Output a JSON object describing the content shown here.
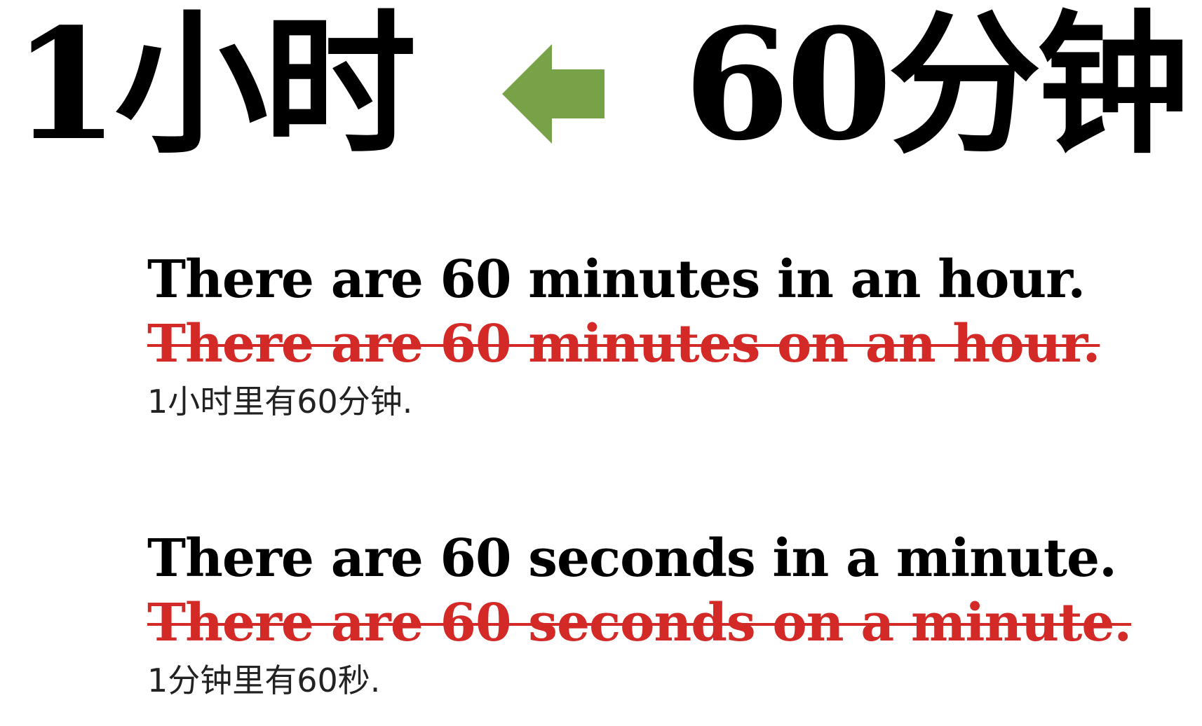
{
  "header": {
    "left_text": "1小时",
    "right_text": "60分钟",
    "arrow_icon": "arrow-left-icon",
    "arrow_color": "#77a248"
  },
  "examples": [
    {
      "correct": "There are 60 minutes in an hour.",
      "wrong": "There are 60 minutes on an hour.",
      "translation": "1小时里有60分钟."
    },
    {
      "correct": "There are 60 seconds in a minute.",
      "wrong": "There are 60 seconds on a minute.",
      "translation": "1分钟里有60秒."
    }
  ],
  "colors": {
    "text": "#000000",
    "wrong": "#d42a27",
    "translation": "#222222",
    "background": "#ffffff"
  }
}
